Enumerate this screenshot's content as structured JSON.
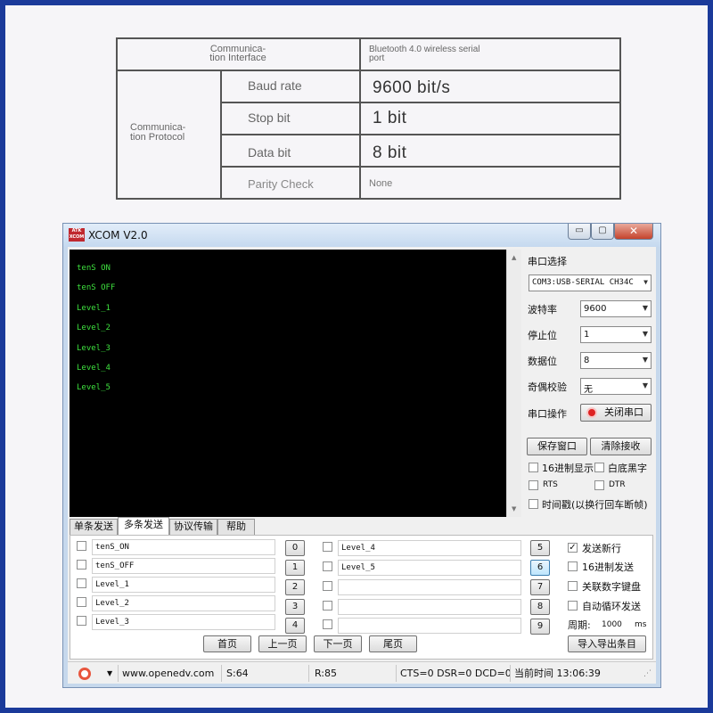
{
  "spec_table": {
    "comm_interface_label": "Communica-\ntion Interface",
    "comm_interface_value": "Bluetooth 4.0 wireless serial\nport",
    "comm_protocol_label": "Communica-\ntion Protocol",
    "rows": [
      {
        "name": "Baud rate",
        "value": "9600 bit/s"
      },
      {
        "name": "Stop bit",
        "value": "1 bit"
      },
      {
        "name": "Data bit",
        "value": "8 bit"
      },
      {
        "name": "Parity Check",
        "value": "None"
      }
    ]
  },
  "window": {
    "logo_text": "ATK\nXCOM",
    "title": "XCOM V2.0",
    "minimize_glyph": "▭",
    "maximize_glyph": "▢",
    "close_glyph": "✕"
  },
  "receive": {
    "lines": [
      "tenS ON",
      "tenS OFF",
      "Level_1",
      "Level_2",
      "Level_3",
      "Level_4",
      "Level_5"
    ],
    "scroll_up": "▲",
    "scroll_down": "▼"
  },
  "serial": {
    "port_label": "串口选择",
    "port_value": "COM3:USB-SERIAL CH34C",
    "baud_label": "波特率",
    "baud_value": "9600",
    "stop_label": "停止位",
    "stop_value": "1",
    "data_label": "数据位",
    "data_value": "8",
    "parity_label": "奇偶校验",
    "parity_value": "无",
    "op_label": "串口操作",
    "op_button": "关闭串口",
    "dropdown_arrow": "▼"
  },
  "options": {
    "save_window": "保存窗口",
    "clear_receive": "清除接收",
    "hex_display": "16进制显示",
    "white_black": "白底黑字",
    "rts": "RTS",
    "dtr": "DTR",
    "timestamp": "时间戳(以换行回车断帧)"
  },
  "tabs": [
    "单条发送",
    "多条发送",
    "协议传输",
    "帮助"
  ],
  "multi_send": {
    "left_items": [
      {
        "text": "tenS_ON",
        "button": "0"
      },
      {
        "text": "tenS_OFF",
        "button": "1"
      },
      {
        "text": "Level_1",
        "button": "2"
      },
      {
        "text": "Level_2",
        "button": "3"
      },
      {
        "text": "Level_3",
        "button": "4"
      }
    ],
    "right_items": [
      {
        "text": "Level_4",
        "button": "5"
      },
      {
        "text": "Level_5",
        "button": "6"
      },
      {
        "text": "",
        "button": "7"
      },
      {
        "text": "",
        "button": "8"
      },
      {
        "text": "",
        "button": "9"
      }
    ],
    "send_newline": "发送新行",
    "send_newline_check": "✓",
    "hex_send": "16进制发送",
    "link_keypad": "关联数字键盘",
    "auto_loop": "自动循环发送",
    "period_label": "周期:",
    "period_value": "1000",
    "period_unit": "ms",
    "first_page": "首页",
    "prev_page": "上一页",
    "next_page": "下一页",
    "last_page": "尾页",
    "import_export": "导入导出条目"
  },
  "status_bar": {
    "arrow": "▼",
    "website": "www.openedv.com",
    "sent": "S:64",
    "received": "R:85",
    "signals": "CTS=0 DSR=0 DCD=0",
    "time": "当前时间 13:06:39",
    "grip": "⋰"
  }
}
